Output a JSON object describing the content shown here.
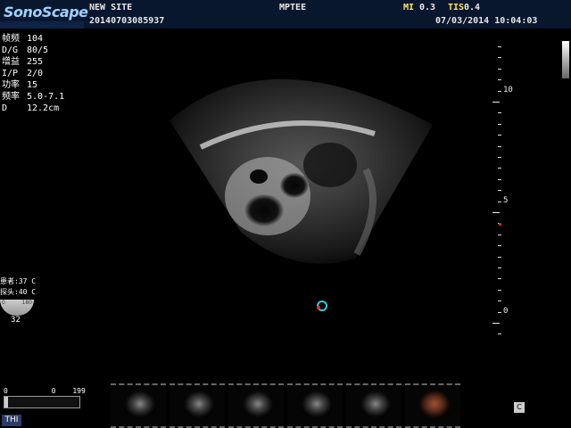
{
  "header": {
    "logo": "SonoScape",
    "site": "NEW SITE",
    "exam_id": "20140703085937",
    "probe": "MPTEE",
    "mi_label": "MI",
    "mi_value": "0.3",
    "tis_label": "TIS",
    "tis_value": "0.4",
    "datetime": "07/03/2014 10:04:03"
  },
  "params": [
    {
      "k": "帧频",
      "v": "104"
    },
    {
      "k": "D/G",
      "v": "80/5"
    },
    {
      "k": "增益",
      "v": "255"
    },
    {
      "k": "I/P",
      "v": "2/0"
    },
    {
      "k": "功率",
      "v": "15"
    },
    {
      "k": "频率",
      "v": "5.0-7.1"
    },
    {
      "k": "D",
      "v": "12.2cm"
    }
  ],
  "depth_scale": {
    "labels": [
      "10",
      "5",
      "0"
    ]
  },
  "temps": {
    "patient": "患者:37 C",
    "probe": "探头:40 C"
  },
  "gauge": {
    "min": "0",
    "max": "180",
    "angle": "32"
  },
  "cine": {
    "start": "0",
    "current": "0",
    "end": "199"
  },
  "thi_label": "THI",
  "c_button": "C",
  "thumbnails": [
    "gray",
    "gray",
    "gray",
    "gray",
    "gray",
    "color"
  ],
  "colors": {
    "header_bg": "#08162e",
    "header_yellow": "#ffe45a",
    "logo": "#9fd0ff"
  }
}
